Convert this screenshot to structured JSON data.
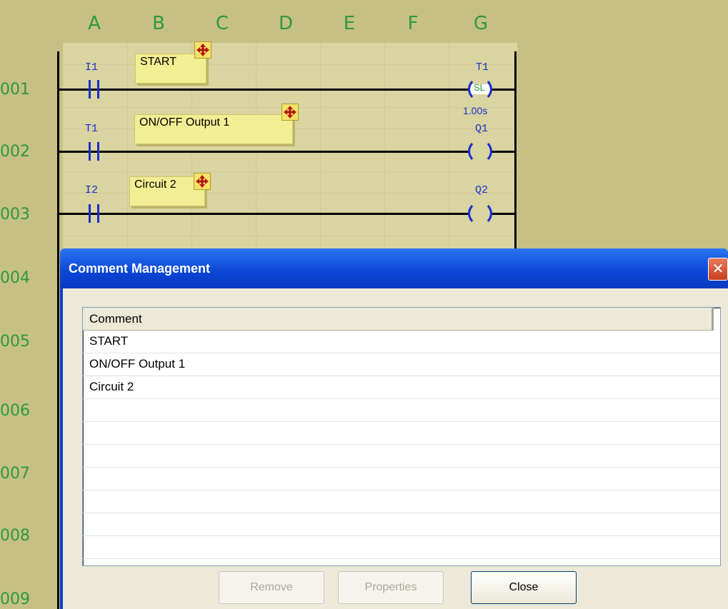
{
  "ladder": {
    "columns": [
      "A",
      "B",
      "C",
      "D",
      "E",
      "F",
      "G"
    ],
    "rows": [
      "001",
      "002",
      "003",
      "004",
      "005",
      "006",
      "007",
      "008",
      "009"
    ],
    "rungs": [
      {
        "contact": "I1",
        "coil": "T1",
        "coil_type": "SL",
        "timer_value": "1.00s",
        "comment": "START"
      },
      {
        "contact": "T1",
        "coil": "Q1",
        "comment": "ON/OFF Output 1"
      },
      {
        "contact": "I2",
        "coil": "Q2",
        "comment": "Circuit 2"
      }
    ]
  },
  "dialog": {
    "title": "Comment Management",
    "close_glyph": "✕",
    "list_header": "Comment",
    "items": [
      "START",
      "ON/OFF Output 1",
      "Circuit 2"
    ],
    "buttons": {
      "remove": "Remove",
      "properties": "Properties",
      "close": "Close"
    }
  },
  "icons": {
    "move": "move-arrows-icon"
  },
  "colors": {
    "background": "#c6c085",
    "label_green": "#2e9a3c",
    "element_blue": "#1a2ed0",
    "titlebar_blue": "#0a45d6"
  }
}
